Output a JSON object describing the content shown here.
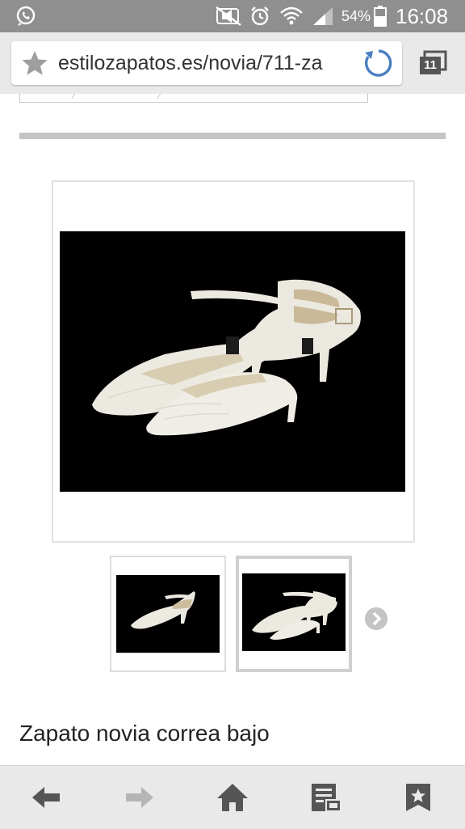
{
  "status_bar": {
    "battery_percent": "54%",
    "time": "16:08",
    "icons": [
      "whatsapp-icon",
      "mute-icon",
      "alarm-icon",
      "wifi-icon",
      "signal-icon",
      "battery-icon"
    ]
  },
  "browser": {
    "url": "estilozapatos.es/novia/711-za",
    "tab_count": "11",
    "icons": [
      "bookmark-star-icon",
      "reload-icon",
      "tabs-icon"
    ]
  },
  "product": {
    "title": "Zapato novia correa bajo",
    "image_count_visible": 2,
    "selected_thumbnail": 2
  },
  "bottom_nav": {
    "buttons": [
      "back-icon",
      "forward-icon",
      "home-icon",
      "reading-list-icon",
      "bookmarks-icon"
    ]
  },
  "colors": {
    "status_bar": "#8f8f8f",
    "toolbar": "#e9e9e9",
    "reload_blue": "#4a7fc1",
    "image_bg": "#000000",
    "shoe_ivory": "#ece9e0"
  }
}
